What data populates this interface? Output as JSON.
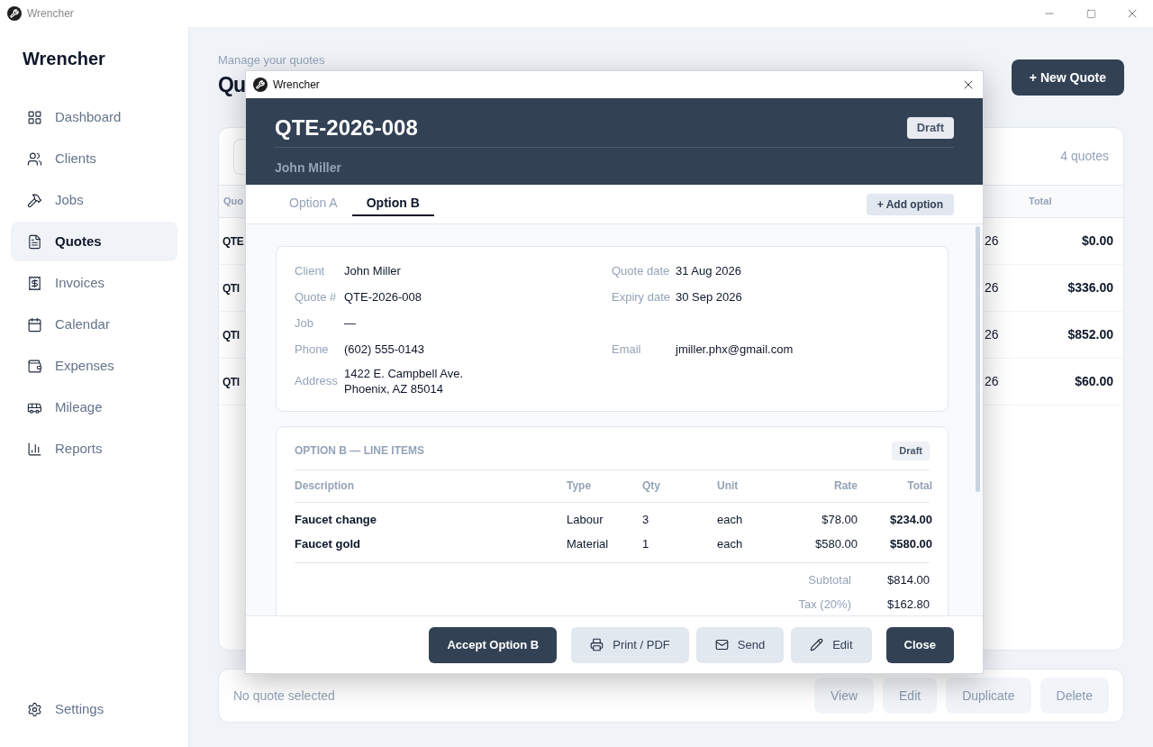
{
  "window": {
    "title": "Wrencher"
  },
  "sidebar": {
    "brand": "Wrencher",
    "items": [
      {
        "label": "Dashboard",
        "selected": false
      },
      {
        "label": "Clients",
        "selected": false
      },
      {
        "label": "Jobs",
        "selected": false
      },
      {
        "label": "Quotes",
        "selected": true
      },
      {
        "label": "Invoices",
        "selected": false
      },
      {
        "label": "Calendar",
        "selected": false
      },
      {
        "label": "Expenses",
        "selected": false
      },
      {
        "label": "Mileage",
        "selected": false
      },
      {
        "label": "Reports",
        "selected": false
      }
    ],
    "settings": "Settings"
  },
  "page": {
    "subtitle": "Manage your quotes",
    "title": "Qu",
    "new_button": "+ New Quote"
  },
  "quotes_list": {
    "count": "4 quotes",
    "columns": [
      "Quo",
      "Total"
    ],
    "rows": [
      {
        "column_1": "QTE",
        "column_2": "26",
        "total": "$0.00"
      },
      {
        "column_1": "QTI",
        "column_2": "26",
        "total": "$336.00"
      },
      {
        "column_1": "QTI",
        "column_2": "26",
        "total": "$852.00"
      },
      {
        "column_1": "QTI",
        "column_2": "26",
        "total": "$60.00"
      }
    ]
  },
  "action_bar": {
    "status": "No quote selected",
    "buttons": [
      {
        "label": "View",
        "disabled": true
      },
      {
        "label": "Edit",
        "disabled": true
      },
      {
        "label": "Duplicate",
        "disabled": true
      },
      {
        "label": "Delete",
        "disabled": true
      }
    ]
  },
  "modal": {
    "title": "Wrencher",
    "quote_number": "QTE-2026-008",
    "status": "Draft",
    "client": "John Miller",
    "tabs": [
      {
        "label": "Option A",
        "selected": false
      },
      {
        "label": "Option B",
        "selected": true
      }
    ],
    "add_option": "+ Add option",
    "details": [
      {
        "left": {
          "label": "Client",
          "value": [
            "John Miller"
          ]
        },
        "right": {
          "label": "Quote date",
          "value": [
            "31 Aug 2026"
          ]
        }
      },
      {
        "left": {
          "label": "Quote #",
          "value": [
            "QTE-2026-008"
          ]
        },
        "right": {
          "label": "Expiry date",
          "value": [
            "30 Sep 2026"
          ]
        }
      },
      {
        "left": {
          "label": "Job",
          "value": [
            "—"
          ]
        }
      },
      {
        "left": {
          "label": "Phone",
          "value": [
            "(602) 555-0143"
          ]
        },
        "right": {
          "label": "Email",
          "value": [
            "jmiller.phx@gmail.com"
          ]
        }
      },
      {
        "left": {
          "label": "Address",
          "value": [
            "1422 E. Campbell Ave.",
            "Phoenix, AZ 85014"
          ]
        }
      }
    ],
    "line_items": {
      "title": "OPTION B — LINE ITEMS",
      "status": "Draft",
      "columns": [
        "Description",
        "Type",
        "Qty",
        "Unit",
        "Rate",
        "Total"
      ],
      "rows": [
        {
          "description": "Faucet change",
          "type": "Labour",
          "qty": "3",
          "unit": "each",
          "rate": "$78.00",
          "total": "$234.00"
        },
        {
          "description": "Faucet gold",
          "type": "Material",
          "qty": "1",
          "unit": "each",
          "rate": "$580.00",
          "total": "$580.00"
        }
      ],
      "totals": [
        {
          "label": "Subtotal",
          "value": "$814.00"
        },
        {
          "label": "Tax (20%)",
          "value": "$162.80"
        }
      ]
    },
    "buttons": [
      {
        "label": "Accept Option B",
        "kind": "primary"
      },
      {
        "label": "Print / PDF",
        "kind": "secondary"
      },
      {
        "label": "Send",
        "kind": "secondary"
      },
      {
        "label": "Edit",
        "kind": "secondary"
      },
      {
        "label": "Close",
        "kind": "primary"
      }
    ]
  }
}
